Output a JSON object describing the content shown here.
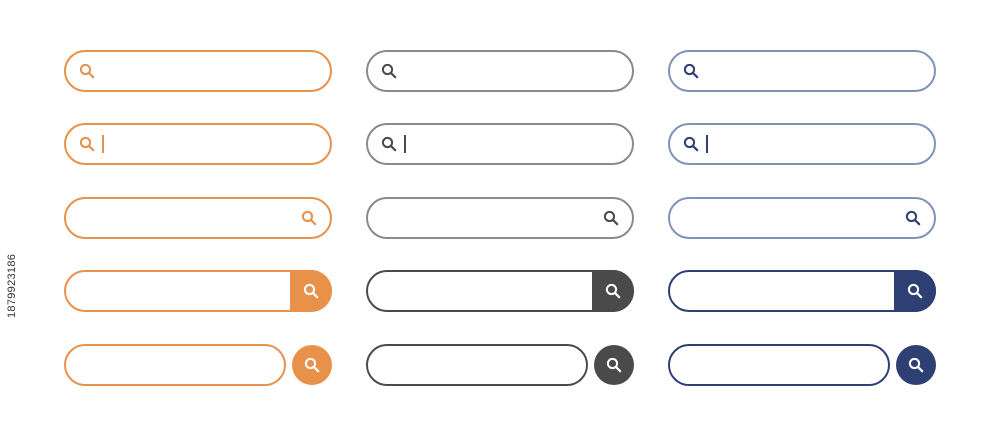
{
  "stock_id": "1879923186",
  "themes": [
    {
      "name": "orange",
      "border": "#E8914A",
      "icon": "#E8914A",
      "button": "#E8914A",
      "button_icon": "#ffffff"
    },
    {
      "name": "gray",
      "border": "#8A8A8A",
      "icon": "#4A4A4A",
      "button": "#4A4A4A",
      "button_icon": "#ffffff"
    },
    {
      "name": "navy",
      "border": "#7F93B8",
      "icon": "#2E3F73",
      "button": "#2E3F73",
      "button_icon": "#ffffff"
    }
  ],
  "variants": [
    "icon-left",
    "icon-left-with-caret",
    "icon-right",
    "attached-button",
    "separate-round-button"
  ],
  "icons": {
    "search": "search-icon"
  },
  "search": {
    "placeholder": ""
  }
}
